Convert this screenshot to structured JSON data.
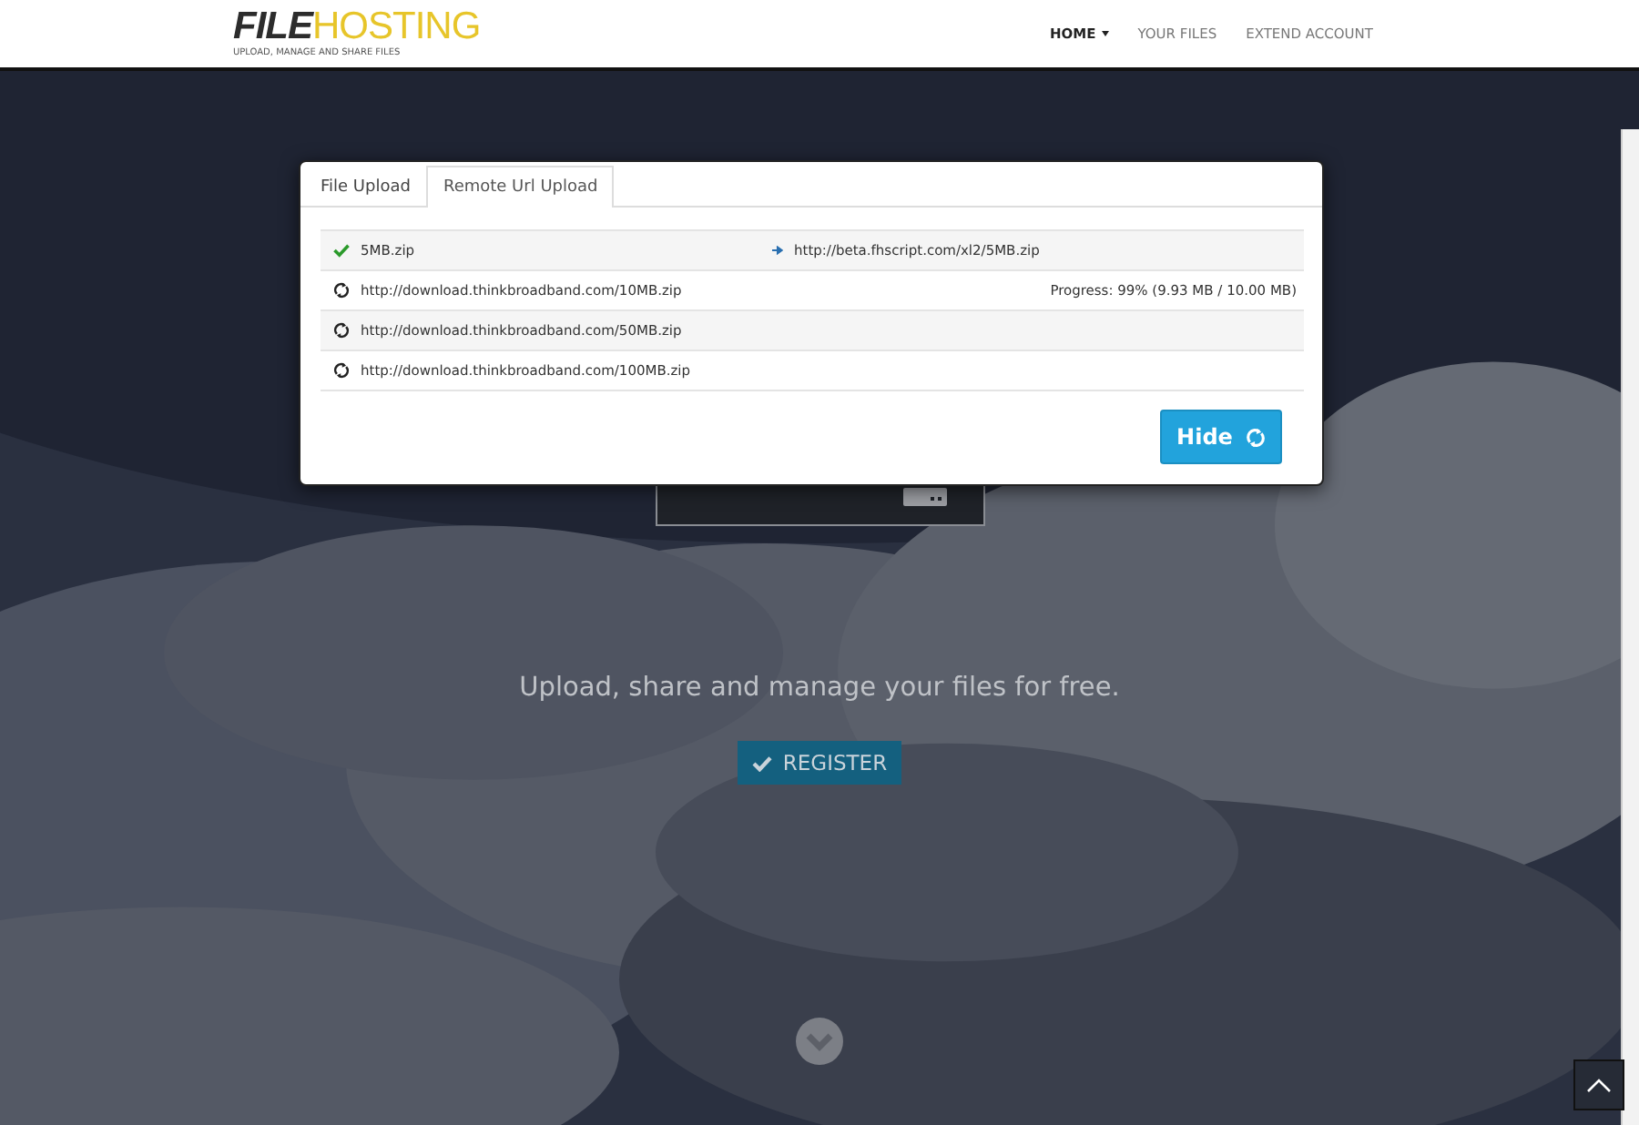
{
  "header": {
    "logo_bold": "FILE",
    "logo_light": "HOSTING",
    "tagline": "UPLOAD, MANAGE AND SHARE FILES",
    "nav": [
      {
        "label": "HOME",
        "selected": true,
        "dropdown": true
      },
      {
        "label": "YOUR FILES",
        "selected": false,
        "dropdown": false
      },
      {
        "label": "EXTEND ACCOUNT",
        "selected": false,
        "dropdown": false
      }
    ]
  },
  "hero": {
    "tagline": "Upload, share and manage your files for free.",
    "register_button": "REGISTER"
  },
  "modal": {
    "tabs": [
      {
        "label": "File Upload",
        "selected": false
      },
      {
        "label": "Remote Url Upload",
        "selected": true
      }
    ],
    "rows": [
      {
        "kind": "done",
        "name": "5MB.zip",
        "link": "http://beta.fhscript.com/xl2/5MB.zip"
      },
      {
        "kind": "pending",
        "name": "http://download.thinkbroadband.com/10MB.zip",
        "progress": "Progress: 99% (9.93 MB / 10.00 MB)"
      },
      {
        "kind": "pending",
        "name": "http://download.thinkbroadband.com/50MB.zip"
      },
      {
        "kind": "pending",
        "name": "http://download.thinkbroadband.com/100MB.zip"
      }
    ],
    "button": "Hide"
  }
}
